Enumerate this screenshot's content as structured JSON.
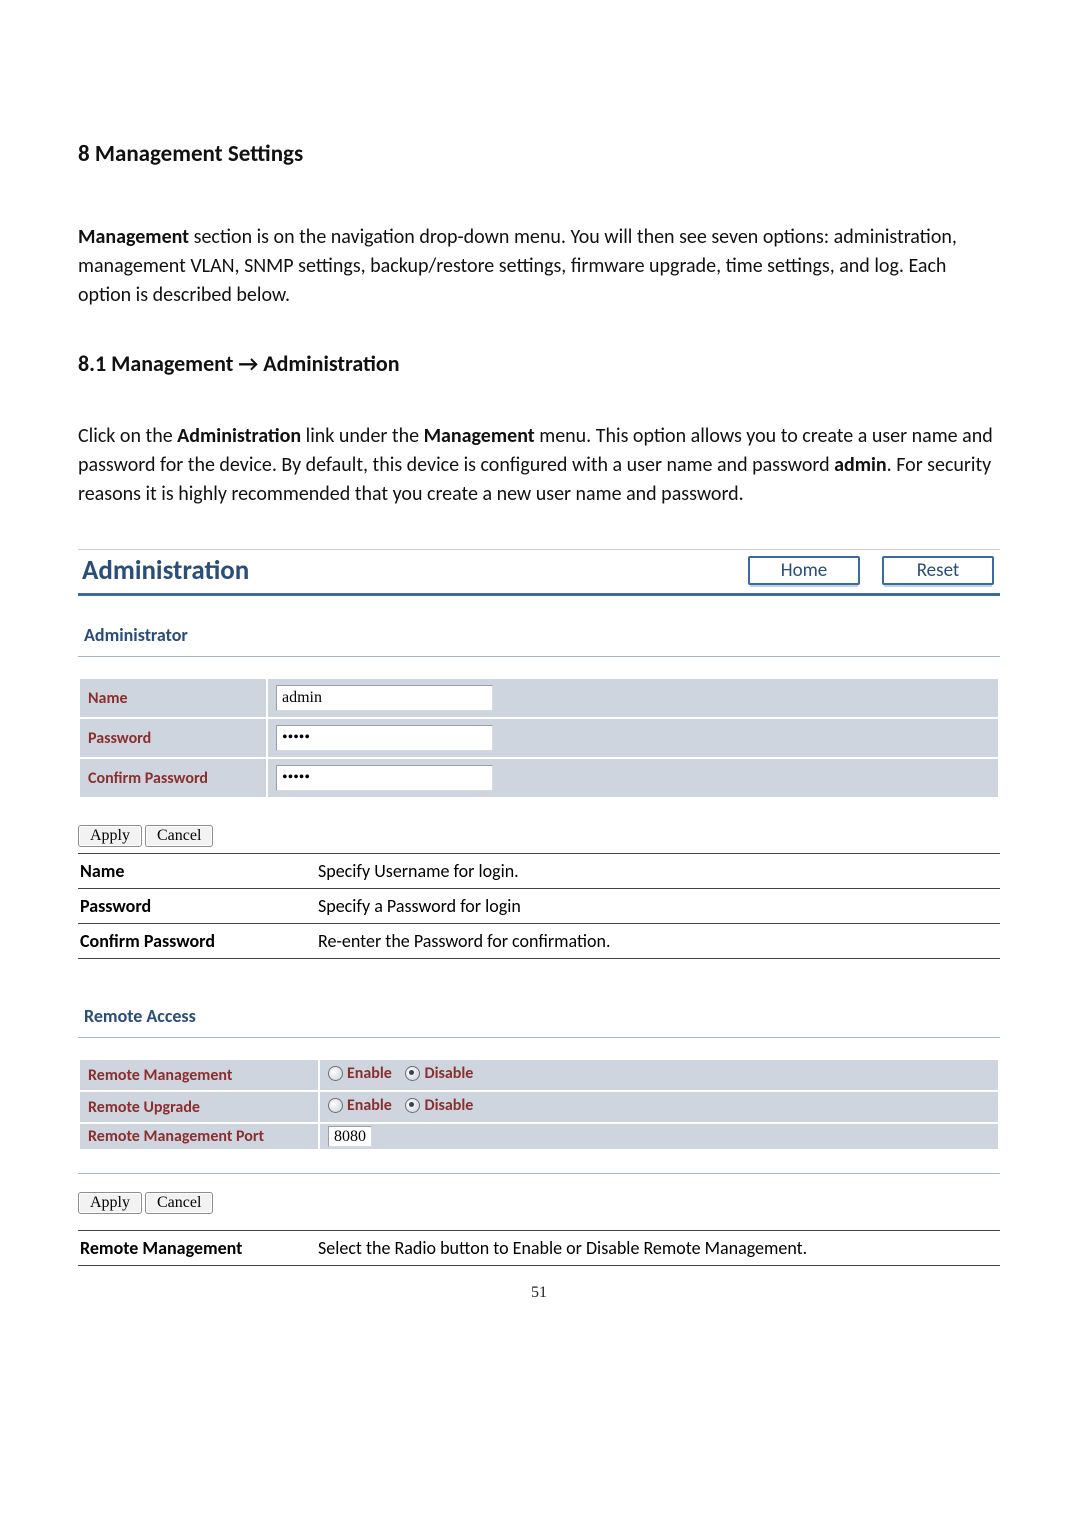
{
  "heading": "8 Management Settings",
  "intro": {
    "strong1": "Management",
    "rest1": " section is on the navigation drop-down menu. You will then see seven options: administration, management VLAN, SNMP settings, backup/restore settings, firmware upgrade, time settings, and log. Each option is described below."
  },
  "subheading": "8.1 Management → Administration",
  "intro2": {
    "pre": "Click on the ",
    "s1": "Administration",
    "mid1": " link under the ",
    "s2": "Management",
    "mid2": " menu. This option allows you to create a user name and password for the device. By default, this device is configured with a user name and password ",
    "s3": "admin",
    "post": ". For security reasons it is highly recommended that you create a new user name and password."
  },
  "panel": {
    "title": "Administration",
    "home": "Home",
    "reset": "Reset",
    "administrator_label": "Administrator",
    "rows": {
      "name_label": "Name",
      "name_value": "admin",
      "password_label": "Password",
      "password_value": "•••••",
      "confirm_label": "Confirm Password",
      "confirm_value": "•••••"
    },
    "apply": "Apply",
    "cancel": "Cancel"
  },
  "doc_table": {
    "name_k": "Name",
    "name_v": "Specify Username for login.",
    "pw_k": "Password",
    "pw_v": "Specify a Password for login",
    "cpw_k": "Confirm Password",
    "cpw_v": "Re-enter the Password for confirmation."
  },
  "remote": {
    "heading": "Remote Access",
    "rm_label": "Remote Management",
    "ru_label": "Remote Upgrade",
    "port_label": "Remote Management Port",
    "port_value": "8080",
    "enable": "Enable",
    "disable": "Disable",
    "apply": "Apply",
    "cancel": "Cancel"
  },
  "doc_table2": {
    "rm_k": "Remote Management",
    "rm_v": "Select the Radio button to Enable or Disable Remote Management."
  },
  "page_number": "51"
}
